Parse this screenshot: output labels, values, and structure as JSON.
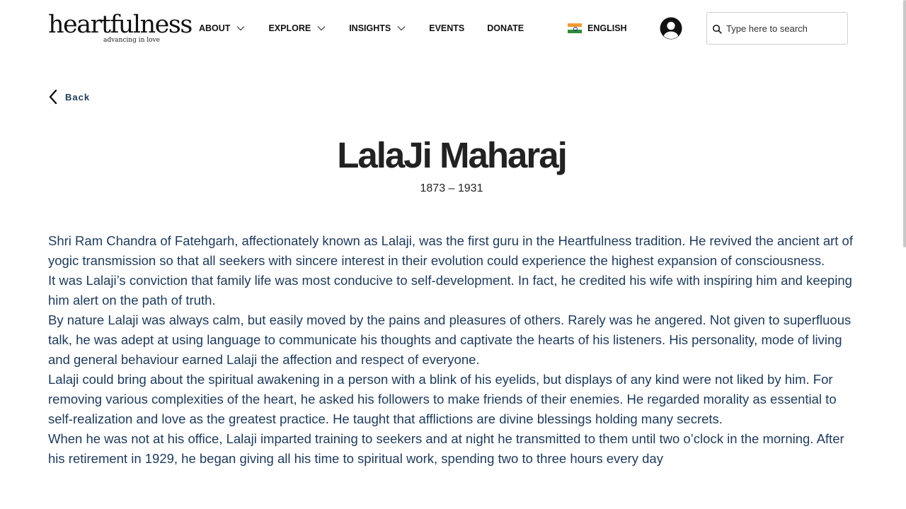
{
  "header": {
    "logo": {
      "name": "heartfulness",
      "tagline": "advancing in love"
    },
    "nav": [
      {
        "label": "ABOUT",
        "has_dropdown": true
      },
      {
        "label": "EXPLORE",
        "has_dropdown": true
      },
      {
        "label": "INSIGHTS",
        "has_dropdown": true
      },
      {
        "label": "EVENTS",
        "has_dropdown": false
      },
      {
        "label": "DONATE",
        "has_dropdown": false
      }
    ],
    "language": {
      "label": "ENGLISH",
      "flag_icon": "india-flag-icon"
    },
    "account_icon": "user-avatar-icon",
    "search": {
      "placeholder": "Type here to search",
      "value": "",
      "icon": "search-icon"
    }
  },
  "back": {
    "label": "Back",
    "icon": "chevron-left-icon"
  },
  "page": {
    "title": "LalaJi Maharaj",
    "dates": "1873 – 1931",
    "paragraphs": [
      "Shri Ram Chandra of Fatehgarh, affectionately known as Lalaji, was the first guru in the Heartfulness tradition. He revived the ancient art of yogic transmission so that all seekers with sincere interest in their evolution could experience the highest expansion of consciousness.",
      "It was Lalaji’s conviction that family life was most conducive to self-development. In fact, he credited his wife with inspiring him and keeping him alert on the path of truth.",
      "By nature Lalaji was always calm, but easily moved by the pains and pleasures of others. Rarely was he angered. Not given to superfluous talk, he was adept at using language to communicate his thoughts and captivate the hearts of his listeners. His personality, mode of living and general behaviour earned Lalaji the affection and respect of everyone.",
      "Lalaji could bring about the spiritual awakening in a person with a blink of his eyelids, but displays of any kind were not liked by him. For removing various complexities of the heart, he asked his followers to make friends of their enemies. He regarded morality as essential to self-realization and love as the greatest practice. He taught that afflictions are divine blessings holding many secrets.",
      "When he was not at his office, Lalaji imparted training to seekers and at night he transmitted to them until two o’clock in the morning. After his retirement in 1929, he began giving all his time to spiritual work, spending two to three hours every day"
    ]
  },
  "colors": {
    "body_text": "#1e3a5a",
    "heading": "#222222",
    "nav_text": "#111111",
    "background": "#ffffff"
  }
}
